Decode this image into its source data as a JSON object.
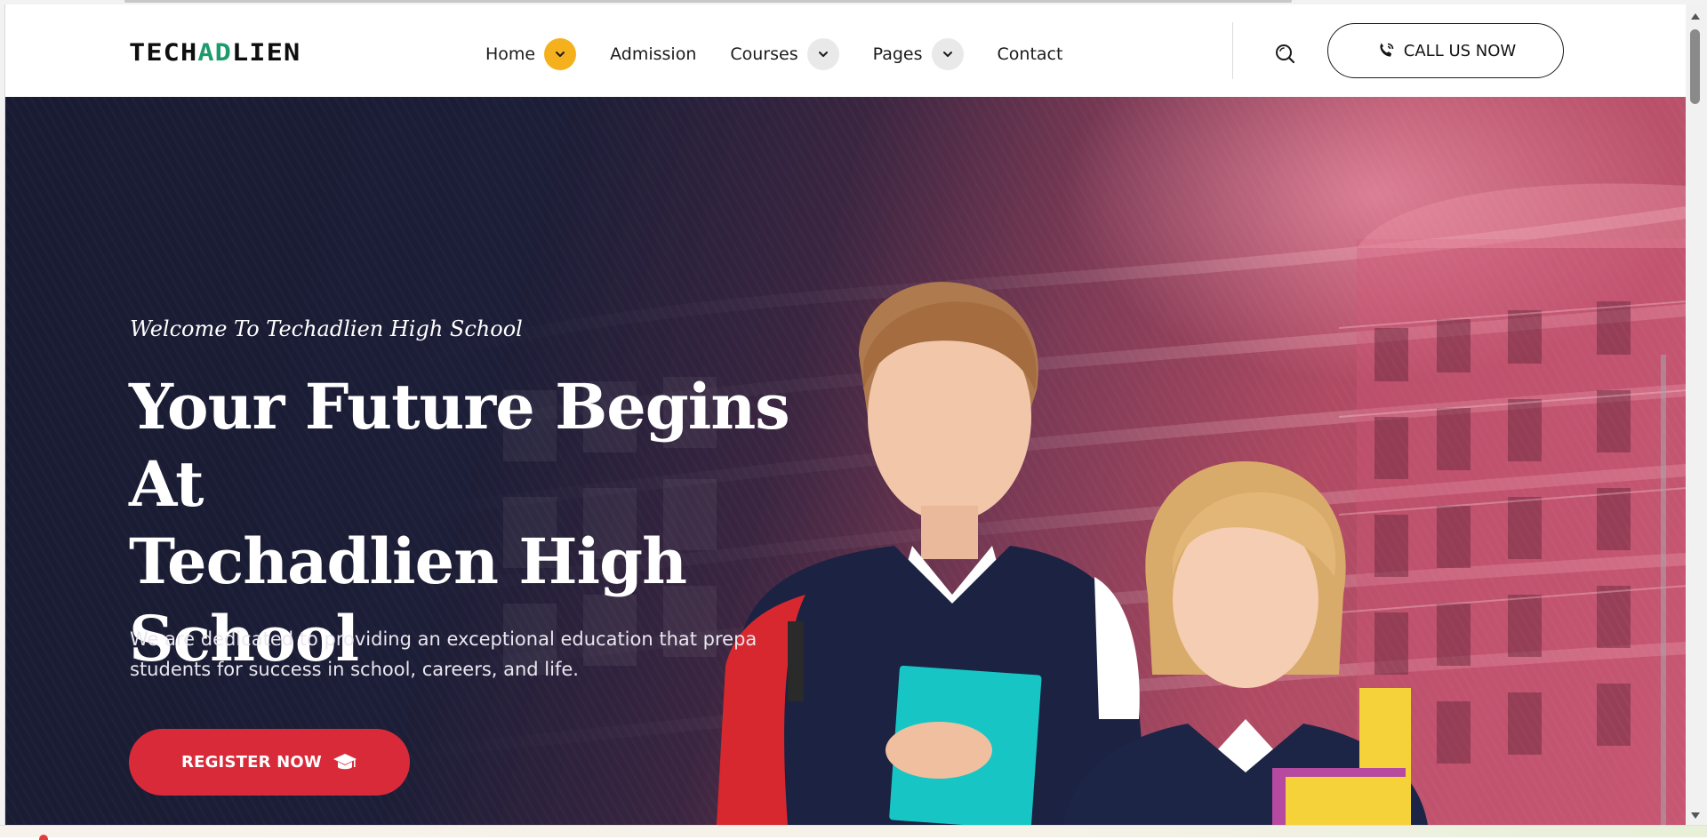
{
  "header": {
    "logo": {
      "part1": "TECH",
      "part2": "AD",
      "part3": "LIEN"
    },
    "nav": [
      {
        "label": "Home",
        "dropdown": true,
        "active": true
      },
      {
        "label": "Admission",
        "dropdown": false
      },
      {
        "label": "Courses",
        "dropdown": true
      },
      {
        "label": "Pages",
        "dropdown": true
      },
      {
        "label": "Contact",
        "dropdown": false
      }
    ],
    "search_icon": "search-icon",
    "call_button": {
      "label": "CALL US NOW",
      "icon": "phone-icon"
    }
  },
  "hero": {
    "welcome": "Welcome To Techadlien High School",
    "title_line1": "Your Future Begins At",
    "title_line2": "Techadlien High",
    "title_line3": "School",
    "description_line1": "We are dedicated to providing an exceptional education that prepa",
    "description_line2": "students for success in school, careers, and life.",
    "register_button": {
      "label": "REGISTER NOW",
      "icon": "graduation-cap-icon"
    }
  },
  "colors": {
    "accent_yellow": "#f4b11d",
    "register_red": "#d92a3a",
    "hero_dark": "#181b32",
    "hero_pink": "#c25670",
    "logo_green": "#1d9b6a"
  }
}
